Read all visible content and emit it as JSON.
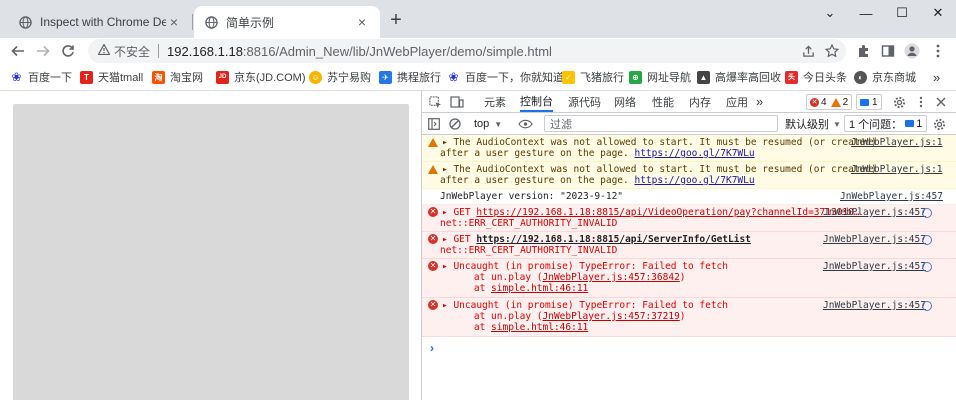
{
  "tabs": [
    {
      "title": "Inspect with Chrome Develope",
      "close": "×"
    },
    {
      "title": "简单示例",
      "close": "×"
    }
  ],
  "new_tab": "+",
  "window_controls": {
    "minimize": "—",
    "maximize": "☐",
    "close": "✕",
    "list": "⌄"
  },
  "address": {
    "insecure_label": "不安全",
    "host": "192.168.1.18",
    "path": ":8816/Admin_New/lib/JnWebPlayer/demo/simple.html"
  },
  "bookmarks": [
    {
      "label": "百度一下",
      "icon": "baidu-paw",
      "color": "#2932e1"
    },
    {
      "label": "天猫tmall",
      "icon": "tmall",
      "color": "#e2231a",
      "glyph": "T"
    },
    {
      "label": "淘宝网",
      "icon": "taobao",
      "color": "#ff5000",
      "glyph": "淘"
    },
    {
      "label": "京东(JD.COM)",
      "icon": "jd",
      "color": "#e1251b",
      "glyph": "JD"
    },
    {
      "label": "苏宁易购",
      "icon": "suning",
      "color": "#f7b500",
      "glyph": "☺"
    },
    {
      "label": "携程旅行",
      "icon": "ctrip",
      "color": "#2577e3",
      "glyph": "✈"
    },
    {
      "label": "百度一下，你就知道",
      "icon": "baidu-paw",
      "color": "#2932e1"
    },
    {
      "label": "飞猪旅行",
      "icon": "fliggy",
      "color": "#ffc300",
      "glyph": "✓"
    },
    {
      "label": "网址导航",
      "icon": "nav",
      "color": "#27a844",
      "glyph": "⊕"
    },
    {
      "label": "高爆率高回收",
      "icon": "mountain",
      "color": "#444444",
      "glyph": "▲"
    },
    {
      "label": "今日头条",
      "icon": "toutiao",
      "color": "#e72b2b",
      "glyph": "头"
    },
    {
      "label": "京东商城",
      "icon": "jd-mall",
      "color": "#555555",
      "glyph": "◐"
    }
  ],
  "bookmarks_more": "»",
  "devtools": {
    "tabs": [
      "元素",
      "控制台",
      "源代码",
      "网络",
      "性能",
      "内存",
      "应用"
    ],
    "more": "»",
    "counts": {
      "errors": "4",
      "warnings": "2",
      "info": "1"
    },
    "filter": {
      "context": "top",
      "placeholder": "过滤",
      "level": "默认级别",
      "issues_label": "1 个问题：",
      "issues_count": "1"
    },
    "messages": [
      {
        "level": "warning",
        "lines": [
          "The AudioContext was not allowed to start. It must be resumed (or created)",
          "after a user gesture on the page."
        ],
        "link": "https://goo.gl/7K7WLu",
        "source": "JnWebPlayer.js:1"
      },
      {
        "level": "warning",
        "lines": [
          "The AudioContext was not allowed to start. It must be resumed (or created)",
          "after a user gesture on the page."
        ],
        "link": "https://goo.gl/7K7WLu",
        "source": "JnWebPlayer.js:1"
      },
      {
        "level": "info",
        "lines": [
          "JnWebPlayer version:  \"2023-9-12\""
        ],
        "source": "JnWebPlayer.js:457"
      },
      {
        "level": "error",
        "method": "GET",
        "url": "https://192.168.1.18:8815/api/VideoOperation/pay?channelId=3713010…",
        "detail": "net::ERR_CERT_AUTHORITY_INVALID",
        "source": "JnWebPlayer.js:457"
      },
      {
        "level": "error",
        "method": "GET",
        "url": "https://192.168.1.18:8815/api/ServerInfo/GetList",
        "detail": "net::ERR_CERT_AUTHORITY_INVALID",
        "source": "JnWebPlayer.js:457"
      },
      {
        "level": "error",
        "lines": [
          "Uncaught (in promise) TypeError: Failed to fetch",
          "    at un.play (",
          "    at "
        ],
        "stack": [
          "JnWebPlayer.js:457:36842",
          "simple.html:46:11"
        ],
        "source": "JnWebPlayer.js:457"
      },
      {
        "level": "error",
        "lines": [
          "Uncaught (in promise) TypeError: Failed to fetch",
          "    at un.play (",
          "    at "
        ],
        "stack": [
          "JnWebPlayer.js:457:37219",
          "simple.html:46:11"
        ],
        "source": "JnWebPlayer.js:457"
      }
    ],
    "prompt": "›"
  }
}
